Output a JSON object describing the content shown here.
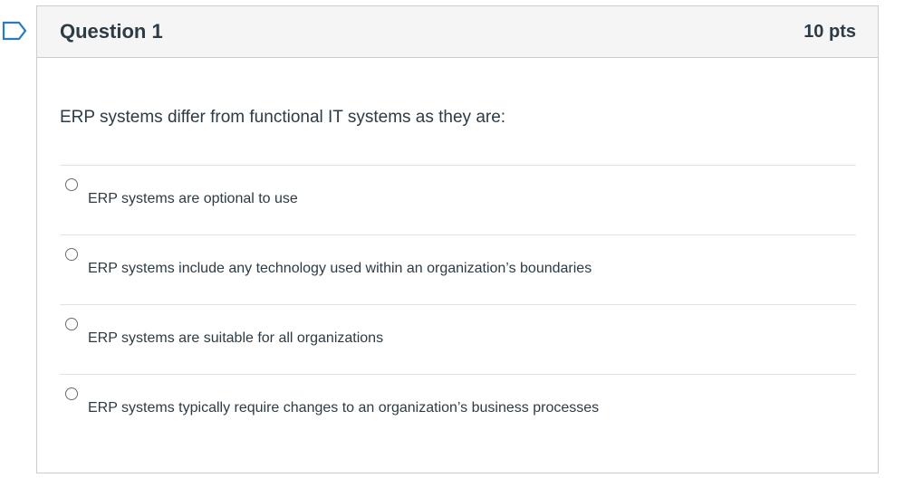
{
  "question": {
    "title": "Question 1",
    "points": "10 pts",
    "text": "ERP systems differ from functional IT systems as they are:",
    "answers": [
      {
        "label": "ERP systems are optional to use"
      },
      {
        "label": "ERP systems include any technology used within an organization’s boundaries"
      },
      {
        "label": "ERP systems are suitable for all organizations"
      },
      {
        "label": "ERP systems typically require changes to an organization’s business processes"
      }
    ]
  },
  "colors": {
    "text": "#2d3b45",
    "header_bg": "#f5f5f5",
    "border": "#c7cdd1",
    "divider": "#dfe3e5",
    "flag": "#2a7abf"
  },
  "icons": {
    "flag": "flag-outline-icon",
    "radio": "radio-unchecked-icon"
  }
}
